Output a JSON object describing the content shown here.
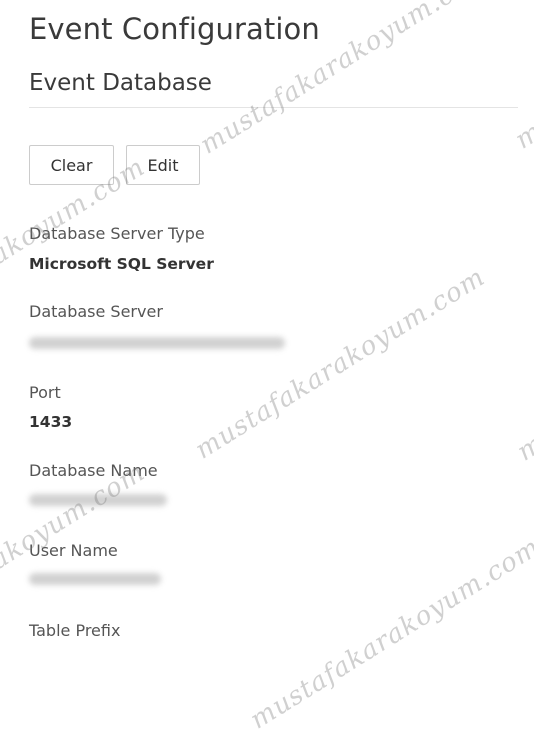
{
  "page": {
    "title": "Event Configuration",
    "section_title": "Event Database"
  },
  "toolbar": {
    "clear_label": "Clear",
    "edit_label": "Edit"
  },
  "fields": {
    "server_type": {
      "label": "Database Server Type",
      "value": "Microsoft SQL Server"
    },
    "server": {
      "label": "Database Server",
      "value_redacted": true
    },
    "port": {
      "label": "Port",
      "value": "1433"
    },
    "database_name": {
      "label": "Database Name",
      "value_redacted": true
    },
    "user_name": {
      "label": "User Name",
      "value_redacted": true
    },
    "table_prefix": {
      "label": "Table Prefix"
    }
  },
  "watermark": {
    "text": "mustafakarakoyum.com"
  }
}
